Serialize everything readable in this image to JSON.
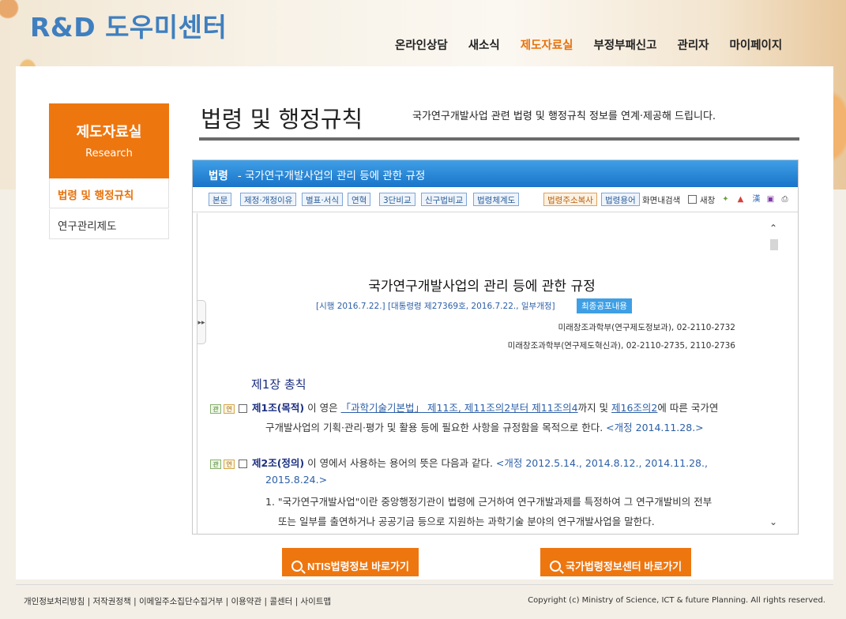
{
  "site": {
    "logo": "R&D 도우미센터"
  },
  "gnb": [
    "온라인상담",
    "새소식",
    "제도자료실",
    "부정부패신고",
    "관리자",
    "마이페이지"
  ],
  "gnb_active": "제도자료실",
  "lnb": {
    "title": "제도자료실",
    "subtitle": "Research",
    "items": [
      "법령 및 행정규칙",
      "연구관리제도"
    ]
  },
  "page": {
    "title": "법령 및 행정규칙",
    "desc": "국가연구개발사업 관련 법령 및 행정규칙 정보를 연계·제공해 드립니다."
  },
  "frame": {
    "head_label": "법령",
    "head_title": "- 국가연구개발사업의 관리 등에 관한 규정",
    "toolbar_left": [
      "본문",
      "제정·개정이유",
      "별표·서식",
      "연혁",
      "3단비교",
      "신구법비교",
      "법령체계도"
    ],
    "toolbar_right": [
      "법령주소복사",
      "법령용어"
    ],
    "toolbar_text1": "화면내검색",
    "toolbar_text2": "새창"
  },
  "law": {
    "title": "국가연구개발사업의 관리 등에 관한 규정",
    "meta": "[시행 2016.7.22.] [대통령령 제27369호, 2016.7.22., 일부개정]",
    "badge": "최종공포내용",
    "dept1": "미래창조과학부(연구제도정보과), 02-2110-2732",
    "dept2": "미래창조과학부(연구제도혁신과), 02-2110-2735, 2110-2736",
    "chapter": "제1장 총칙",
    "tag1": "관",
    "tag2": "연",
    "art1_no": "제1조(목적)",
    "art1_a": " 이 영은 ",
    "art1_link1": "「과학기술기본법」 제11조, 제11조의2부터 제11조의4",
    "art1_b": "까지 및 ",
    "art1_link2": "제16조의2",
    "art1_c": "에 따른 국가연",
    "art1_line2": "구개발사업의 기획·관리·평가 및 활용 등에 필요한 사항을 규정함을 목적으로 한다.",
    "art1_rev": "<개정 2014.11.28.>",
    "art2_no": "제2조(정의)",
    "art2_a": " 이 영에서 사용하는 용어의 뜻은 다음과 같다. ",
    "art2_rev": "<개정 2012.5.14., 2014.8.12., 2014.11.28.,",
    "art2_rev2": "2015.8.24.>",
    "art2_item1": "1. \"국가연구개발사업\"이란 중앙행정기관이 법령에 근거하여 연구개발과제를 특정하여 그 연구개발비의 전부",
    "art2_item1b": "또는 일부를 출연하거나 공공기금 등으로 지원하는 과학기술 분야의 연구개발사업을 말한다."
  },
  "buttons": [
    "NTIS법령정보 바로가기",
    "국가법령정보센터 바로가기"
  ],
  "footer": {
    "links": "개인정보처리방침 | 저작권정책 | 이메일주소집단수집거부 | 이용약관 | 콜센터 | 사이트맵",
    "copyright": "Copyright (c) Ministry of Science, ICT & future Planning. All rights reserved."
  }
}
